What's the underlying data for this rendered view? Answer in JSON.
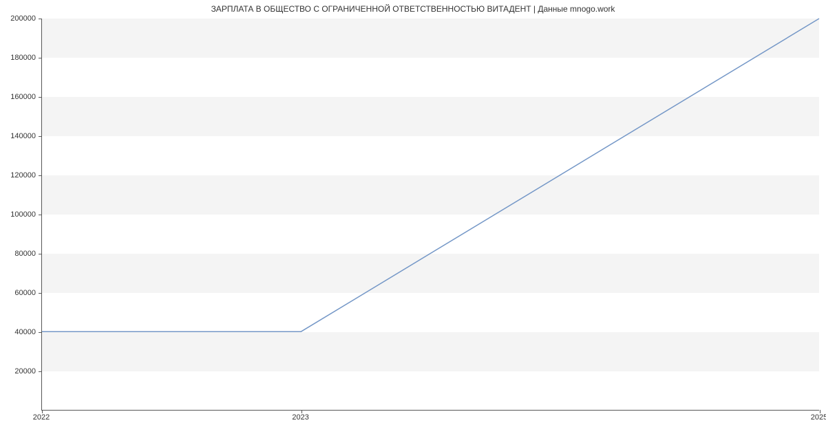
{
  "chart_data": {
    "type": "line",
    "title": "ЗАРПЛАТА В ОБЩЕСТВО С ОГРАНИЧЕННОЙ  ОТВЕТСТВЕННОСТЬЮ ВИТАДЕНТ | Данные mnogo.work",
    "x": [
      2022,
      2023,
      2025
    ],
    "values": [
      40000,
      40000,
      200000
    ],
    "x_ticks": [
      2022,
      2023,
      2025
    ],
    "y_ticks": [
      20000,
      40000,
      60000,
      80000,
      100000,
      120000,
      140000,
      160000,
      180000,
      200000
    ],
    "xlabel": "",
    "ylabel": "",
    "xlim": [
      2022,
      2025
    ],
    "ylim": [
      0,
      200000
    ],
    "grid": "horizontal-bands",
    "line_color": "#7497c7"
  }
}
